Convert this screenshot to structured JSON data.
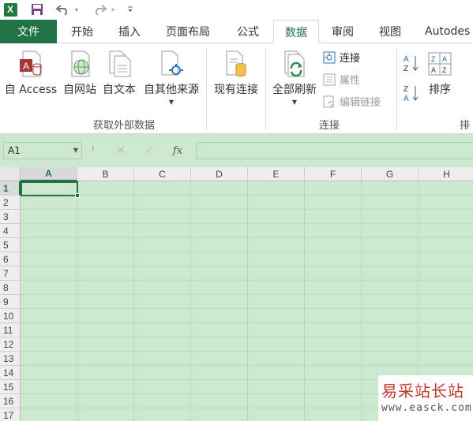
{
  "quick_access": {
    "app_icon_text": "X",
    "icons": [
      "excel-app-icon",
      "save-icon",
      "undo-icon",
      "redo-icon",
      "customize-dropdown-icon"
    ]
  },
  "tabs": [
    {
      "label": "文件",
      "name": "tab-file"
    },
    {
      "label": "开始",
      "name": "tab-home"
    },
    {
      "label": "插入",
      "name": "tab-insert"
    },
    {
      "label": "页面布局",
      "name": "tab-page-layout"
    },
    {
      "label": "公式",
      "name": "tab-formulas"
    },
    {
      "label": "数据",
      "name": "tab-data",
      "active": true
    },
    {
      "label": "审阅",
      "name": "tab-review"
    },
    {
      "label": "视图",
      "name": "tab-view"
    },
    {
      "label": "Autodes",
      "name": "tab-autodesk"
    }
  ],
  "ribbon": {
    "get_external": {
      "group_label": "获取外部数据",
      "from_access": "自 Access",
      "from_web": "自网站",
      "from_text": "自文本",
      "from_other": "自其他来源"
    },
    "existing_connections": "现有连接",
    "connections": {
      "group_label": "连接",
      "refresh_all": "全部刷新",
      "connections_btn": "连接",
      "properties_btn": "属性",
      "edit_links_btn": "编辑链接"
    },
    "sort": {
      "group_label_partial": "排",
      "sort_btn": "排序",
      "sort_az_icon_text": "ZA",
      "sort_za_icon_text": "AZ"
    }
  },
  "formula_bar": {
    "name_box": "A1",
    "fx": "fx",
    "formula_value": ""
  },
  "grid": {
    "columns": [
      "A",
      "B",
      "C",
      "D",
      "E",
      "F",
      "G",
      "H"
    ],
    "rows": [
      "1",
      "2",
      "3",
      "4",
      "5",
      "6",
      "7",
      "8",
      "9",
      "10",
      "11",
      "12",
      "13",
      "14",
      "15",
      "16",
      "17"
    ],
    "active_cell": "A1"
  },
  "watermark": {
    "title": "易采站长站",
    "url": "www.easck.com"
  },
  "colors": {
    "excel_green": "#217346",
    "sheet_bg": "#cce8cf",
    "watermark_red": "#c0392b"
  }
}
